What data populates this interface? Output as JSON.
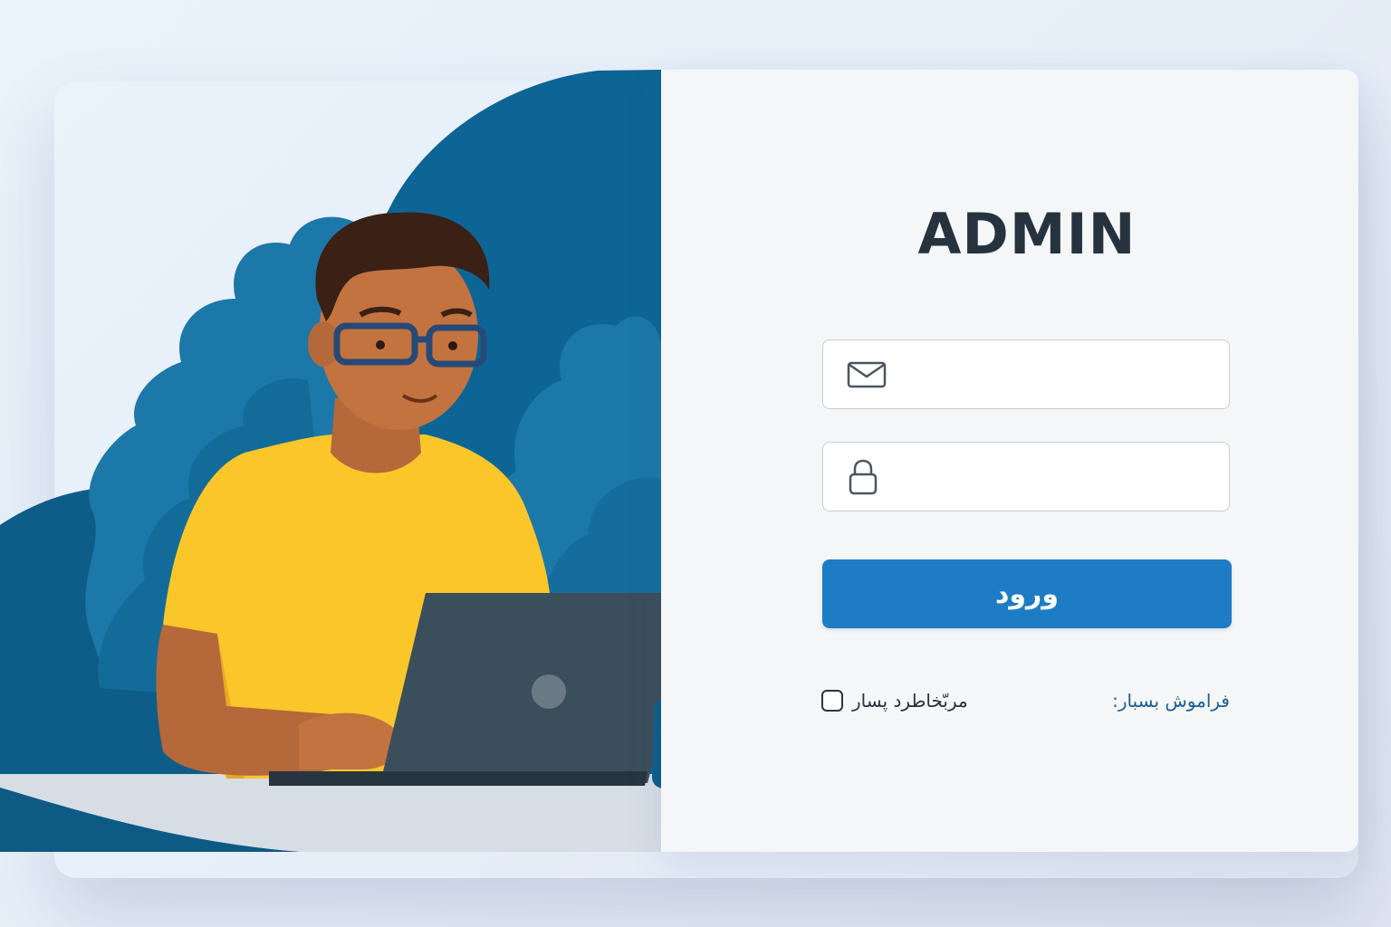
{
  "login": {
    "title": "ADMIN",
    "email_field": {
      "value": "",
      "placeholder": "",
      "icon": "envelope-icon"
    },
    "password_field": {
      "value": "",
      "placeholder": "",
      "icon": "lock-icon"
    },
    "submit_label": "ورود",
    "remember_label": "مربّخاطرد پسار",
    "forgot_label": "فراموش بسبار:"
  },
  "colors": {
    "accent": "#1d7cc3",
    "panel_background": "#f4f6f8",
    "illustration_blue": "#0d6596",
    "shirt_yellow": "#fbc62a",
    "title_text": "#26323e",
    "link_text": "#1b5f93"
  },
  "illustration": {
    "subject": "person-with-laptop",
    "items": [
      "person-with-glasses",
      "laptop",
      "coffee-mug",
      "foliage",
      "desk"
    ]
  }
}
